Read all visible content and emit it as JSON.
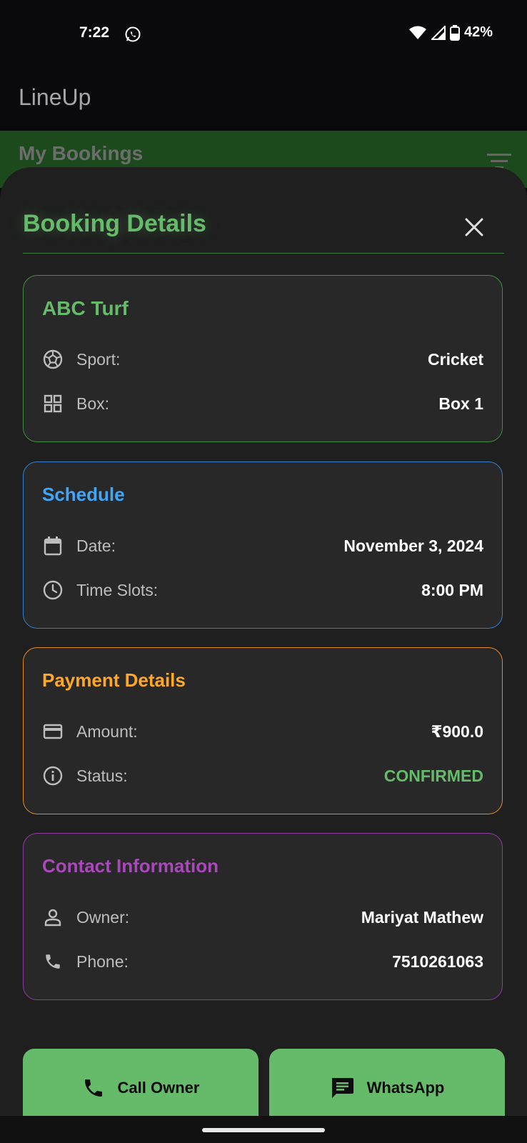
{
  "status_bar": {
    "time": "7:22",
    "battery": "42%"
  },
  "app": {
    "title": "LineUp"
  },
  "tab": {
    "title": "My Bookings"
  },
  "sheet": {
    "title": "Booking Details",
    "venue": {
      "name": "ABC Turf",
      "sport_label": "Sport:",
      "sport_value": "Cricket",
      "box_label": "Box:",
      "box_value": "Box 1"
    },
    "schedule": {
      "title": "Schedule",
      "date_label": "Date:",
      "date_value": "November 3, 2024",
      "time_label": "Time Slots:",
      "time_value": "8:00 PM"
    },
    "payment": {
      "title": "Payment Details",
      "amount_label": "Amount:",
      "amount_value": "₹900.0",
      "status_label": "Status:",
      "status_value": "CONFIRMED"
    },
    "contact": {
      "title": "Contact Information",
      "owner_label": "Owner:",
      "owner_value": "Mariyat Mathew",
      "phone_label": "Phone:",
      "phone_value": "7510261063"
    }
  },
  "actions": {
    "call_label": "Call Owner",
    "whatsapp_label": "WhatsApp"
  },
  "colors": {
    "venue_accent": "#66bb6a",
    "schedule_accent": "#42a5f5",
    "payment_accent": "#ffa726",
    "contact_accent": "#ab47bc",
    "confirmed": "#66bb6a"
  },
  "icons": [
    "whatsapp-icon",
    "wifi-icon",
    "signal-icon",
    "battery-icon",
    "filter-icon",
    "close-icon",
    "sport-icon",
    "grid-icon",
    "calendar-icon",
    "clock-icon",
    "credit-card-icon",
    "info-icon",
    "person-icon",
    "phone-icon",
    "message-icon"
  ]
}
